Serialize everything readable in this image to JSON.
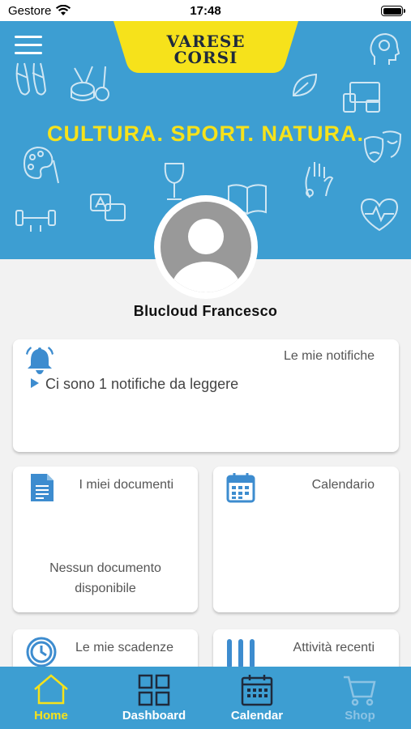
{
  "status_bar": {
    "carrier": "Gestore",
    "time": "17:48"
  },
  "hero": {
    "brand_line1": "VARESE",
    "brand_line2": "CORSI",
    "slogan": "CULTURA. SPORT. NATURA."
  },
  "colors": {
    "primary": "#3d9ed2",
    "accent": "#f6e21b",
    "active_tab": "#f6e21b",
    "disabled_tab": "#8cc3e4"
  },
  "user": {
    "name": "Blucloud Francesco"
  },
  "cards": {
    "notifications": {
      "title": "Le mie notifiche",
      "message": "Ci sono 1 notifiche da leggere",
      "icon": "bell-icon"
    },
    "documents": {
      "title": "I miei documenti",
      "empty_line1": "Nessun documento",
      "empty_line2": "disponibile",
      "icon": "document-icon"
    },
    "calendar": {
      "title": "Calendario",
      "icon": "calendar-icon"
    },
    "deadlines": {
      "title": "Le mie scadenze",
      "icon": "clock-icon"
    },
    "recent": {
      "title": "Attività recenti",
      "icon": "bars-icon"
    }
  },
  "tabs": [
    {
      "label": "Home",
      "icon": "home-icon",
      "state": "active"
    },
    {
      "label": "Dashboard",
      "icon": "dashboard-icon",
      "state": "normal"
    },
    {
      "label": "Calendar",
      "icon": "calendar-icon",
      "state": "normal"
    },
    {
      "label": "Shop",
      "icon": "cart-icon",
      "state": "disabled"
    }
  ]
}
